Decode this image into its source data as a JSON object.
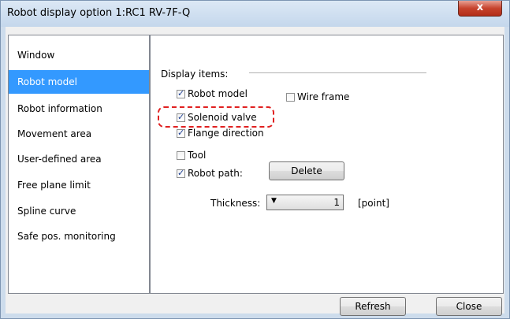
{
  "window": {
    "title": "Robot display option 1:RC1 RV-7F-Q",
    "close_glyph": "x"
  },
  "sidebar": {
    "items": [
      {
        "label": "Window"
      },
      {
        "label": "Robot model"
      },
      {
        "label": "Robot information"
      },
      {
        "label": "Movement area"
      },
      {
        "label": "User-defined area"
      },
      {
        "label": "Free plane limit"
      },
      {
        "label": "Spline curve"
      },
      {
        "label": "Safe pos. monitoring"
      }
    ],
    "selected_index": 1
  },
  "display_items": {
    "group_label": "Display items:",
    "robot_model": {
      "label": "Robot model",
      "checked": true
    },
    "wire_frame": {
      "label": "Wire frame",
      "checked": false
    },
    "solenoid_valve": {
      "label": "Solenoid valve",
      "checked": true
    },
    "flange_direction": {
      "label": "Flange direction",
      "checked": true
    },
    "tool": {
      "label": "Tool",
      "checked": false
    },
    "robot_path": {
      "label": "Robot path:",
      "checked": true
    },
    "delete_label": "Delete",
    "thickness_label": "Thickness:",
    "thickness_value": "1",
    "thickness_unit": "[point]"
  },
  "footer": {
    "refresh_label": "Refresh",
    "close_label": "Close"
  }
}
